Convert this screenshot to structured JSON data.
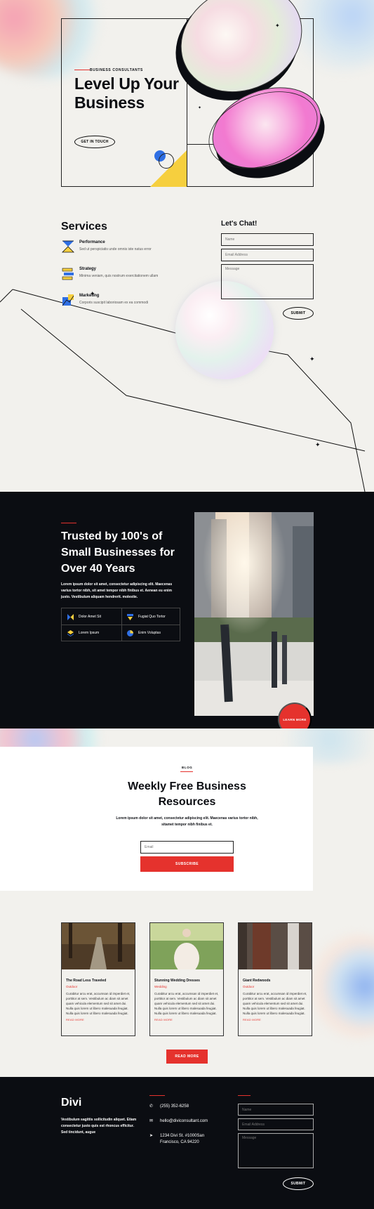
{
  "hero": {
    "eyebrow": "BUSINESS CONSULTANTS",
    "title": "Level Up Your Business",
    "cta": "GET IN TOUCH"
  },
  "services": {
    "title": "Services",
    "items": [
      {
        "title": "Performance",
        "desc": "Sed ut perspiciatis unde omnis iste natus error",
        "icon": "hourglass-icon"
      },
      {
        "title": "Strategy",
        "desc": "Minima veniam, quis nostrum exercitationem ullam",
        "icon": "stack-icon"
      },
      {
        "title": "Marketing",
        "desc": "Corporis suscipit laboriosam ex ea commodi",
        "icon": "chart-icon"
      }
    ]
  },
  "chat": {
    "title": "Let's Chat!",
    "name_placeholder": "Name",
    "email_placeholder": "Email Address",
    "message_placeholder": "Message",
    "submit": "SUBMIT"
  },
  "trusted": {
    "title": "Trusted by 100's of Small Businesses for Over 40 Years",
    "body": "Lorem ipsum dolor sit amet, consectetur adipiscing elit. Maecenas varius tortor nibh, sit amet tempor nibh finibus et. Aenean eu enim justo. Vestibulum aliquam hendrerit. molestie.",
    "features": [
      "Dolor Amet Sit",
      "Fugiat Quo Tortor",
      "Lorem Ipsum",
      "Enim Voluptas"
    ],
    "cta": "LEARN MORE"
  },
  "blog_sub": {
    "eyebrow": "BLOG",
    "title": "Weekly Free Business Resources",
    "body": "Lorem ipsum dolor sit amet, consectetur adipiscing elit. Maecenas varius tortor nibh, sitamet tempor nibh finibus et.",
    "email_placeholder": "Email",
    "subscribe": "SUBSCRIBE"
  },
  "posts": {
    "items": [
      {
        "title": "The Road Less Traveled",
        "category": "Outdoor",
        "excerpt": "Curabitur arcu erat, accumsan id imperdiet et, porttitor at sem. Vestibulum ac diam sit amet quam vehicula elementum sed sit amet dui. Nulla quis lorem ut libero malesuada feugiat. Nulla quis lorem ut libero malesuada feugiat.",
        "more": "READ MORE"
      },
      {
        "title": "Stunning Wedding Dresses",
        "category": "Wedding",
        "excerpt": "Curabitur arcu erat, accumsan id imperdiet et, porttitor at sem. Vestibulum ac diam sit amet quam vehicula elementum sed sit amet dui. Nulla quis lorem ut libero malesuada feugiat. Nulla quis lorem ut libero malesuada feugiat.",
        "more": "READ MORE"
      },
      {
        "title": "Giant Redwoods",
        "category": "Outdoor",
        "excerpt": "Curabitur arcu erat, accumsan id imperdiet et, porttitor at sem. Vestibulum ac diam sit amet quam vehicula elementum sed sit amet dui. Nulla quis lorem ut libero malesuada feugiat. Nulla quis lorem ut libero malesuada feugiat.",
        "more": "READ MORE"
      }
    ],
    "more_button": "READ MORE"
  },
  "footer": {
    "logo": "Divi",
    "body": "Vestibulum sagittis sollicitudin aliquet. Etiam consectetur justo quis est rhoncus efficitur. Sed tincidunt, augue",
    "phone": "(255) 352-6258",
    "email": "hello@diviconsultant.com",
    "address": "1234 Divi St. #1000San Francisco, CA 94220",
    "form": {
      "name_placeholder": "Name",
      "email_placeholder": "Email Address",
      "message_placeholder": "Message",
      "submit": "SUBMIT"
    }
  },
  "colors": {
    "accent": "#e5322d",
    "dark": "#0b0d12",
    "background": "#f2f1ed"
  }
}
